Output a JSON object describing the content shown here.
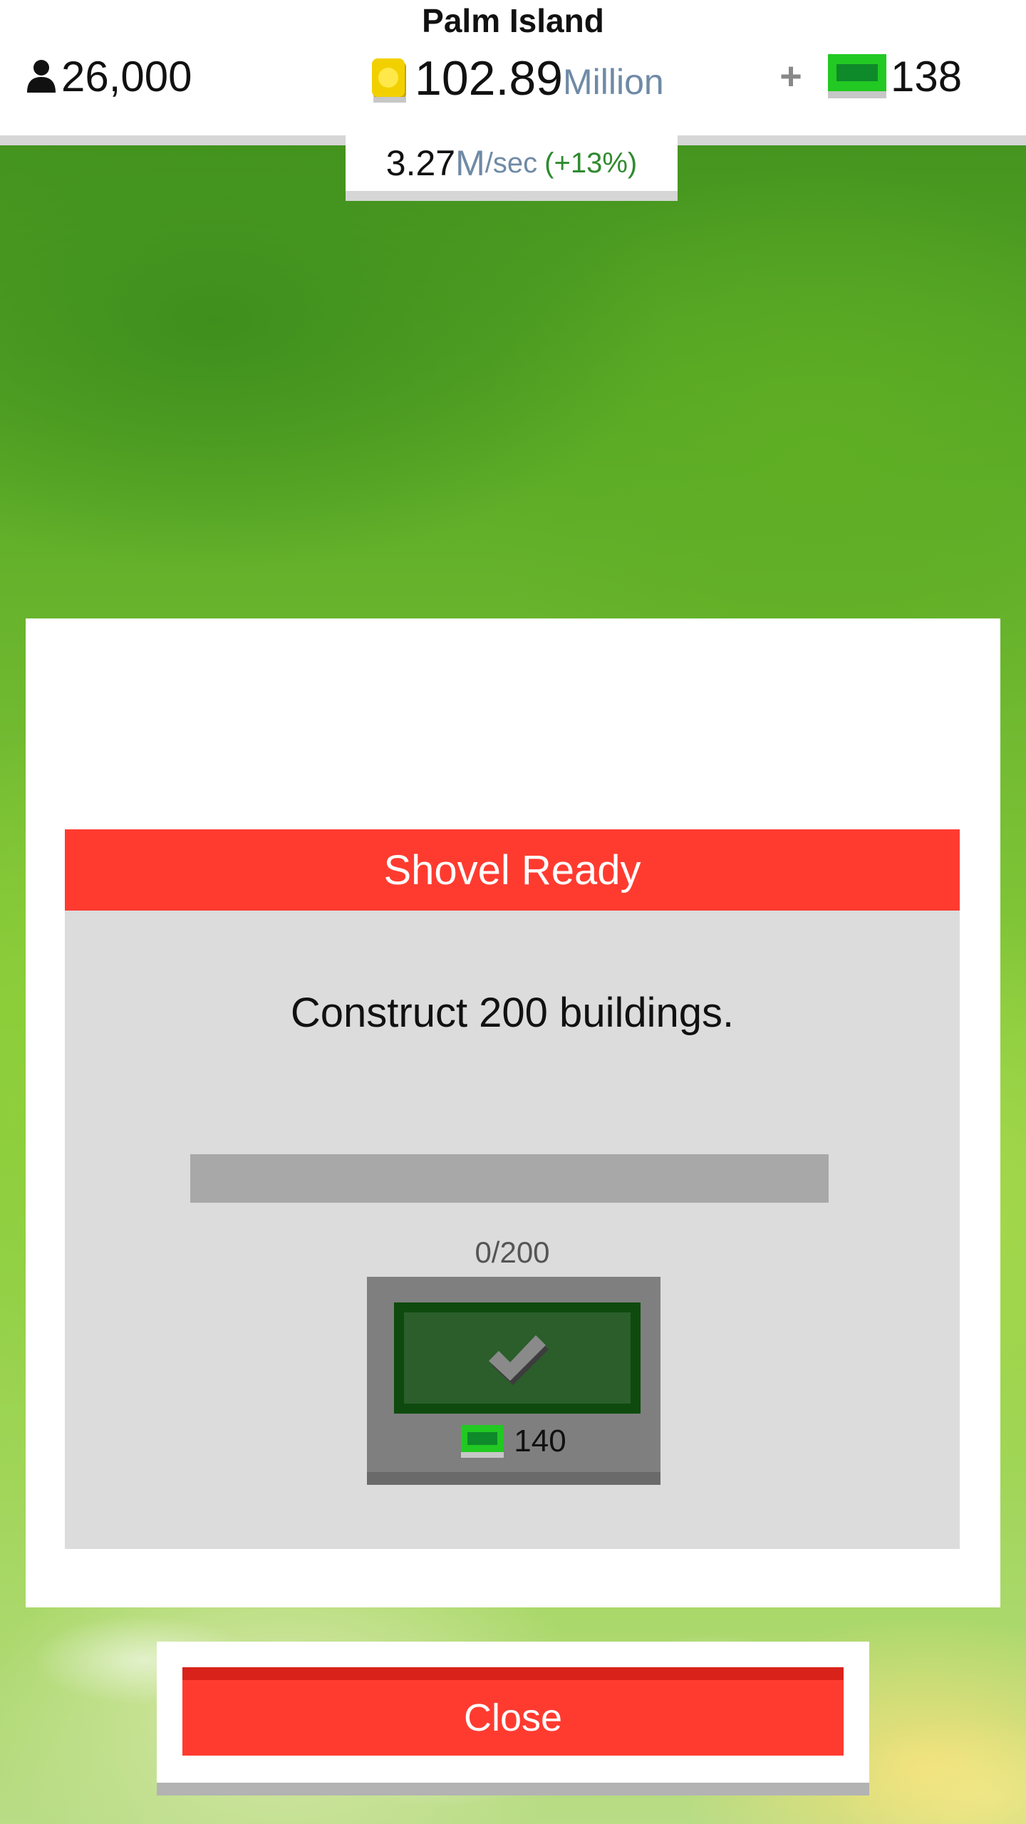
{
  "hud": {
    "city_name": "Palm Island",
    "population": "26,000",
    "money_value": "102.89",
    "money_unit": "Million",
    "plus_label": "+",
    "cash_value": "138",
    "rate_value": "3.27",
    "rate_unit_m": "M",
    "rate_unit_sec": "/sec",
    "rate_bonus": "(+13%)"
  },
  "achievement": {
    "title": "Shovel Ready",
    "goal": "Construct 200 buildings.",
    "progress_current": 0,
    "progress_total": 200,
    "progress_text": "0/200",
    "reward_amount": "140"
  },
  "close_label": "Close",
  "colors": {
    "header_red": "#ff3b30",
    "cash_green": "#22c922",
    "claim_dark_green": "#0e4a0e",
    "unit_blue_gray": "#6f8aa6",
    "bonus_green": "#2f8a2f"
  },
  "icons": {
    "population": "person-icon",
    "money": "coin-icon",
    "cash": "cash-bill-icon",
    "claim": "checkmark-icon"
  }
}
